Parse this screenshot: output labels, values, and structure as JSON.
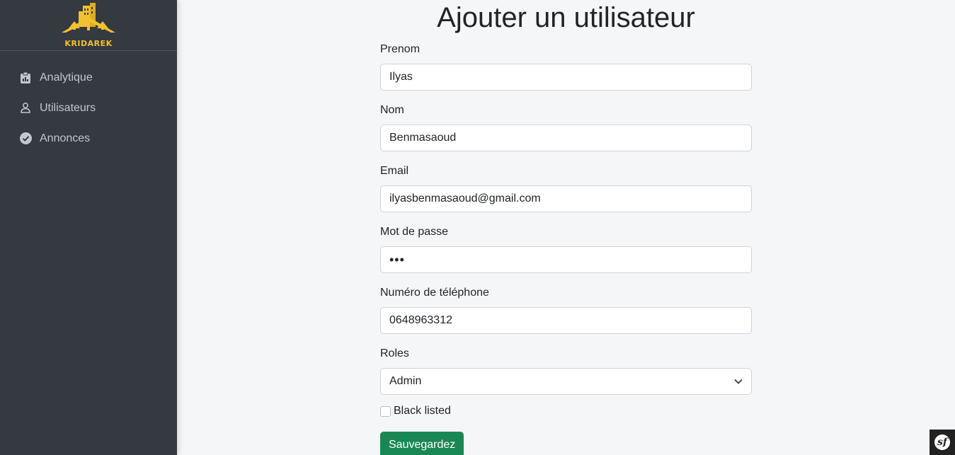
{
  "brand": {
    "name": "KRIDAREK",
    "accent": "#f2c12e"
  },
  "sidebar": {
    "items": [
      {
        "label": "Analytique",
        "icon": "clipboard-icon"
      },
      {
        "label": "Utilisateurs",
        "icon": "user-icon"
      },
      {
        "label": "Annonces",
        "icon": "check-circle-icon"
      }
    ]
  },
  "page": {
    "title": "Ajouter un utilisateur"
  },
  "form": {
    "prenom": {
      "label": "Prenom",
      "value": "Ilyas"
    },
    "nom": {
      "label": "Nom",
      "value": "Benmasaoud"
    },
    "email": {
      "label": "Email",
      "value": "ilyasbenmasaoud@gmail.com"
    },
    "password": {
      "label": "Mot de passe",
      "value": "•••"
    },
    "phone": {
      "label": "Numéro de téléphone",
      "value": "0648963312"
    },
    "roles": {
      "label": "Roles",
      "selected": "Admin"
    },
    "blacklisted": {
      "label": "Black listed",
      "checked": false
    },
    "submit_label": "Sauvegardez"
  },
  "colors": {
    "sidebar_bg": "#343a40",
    "submit_bg": "#198754"
  }
}
